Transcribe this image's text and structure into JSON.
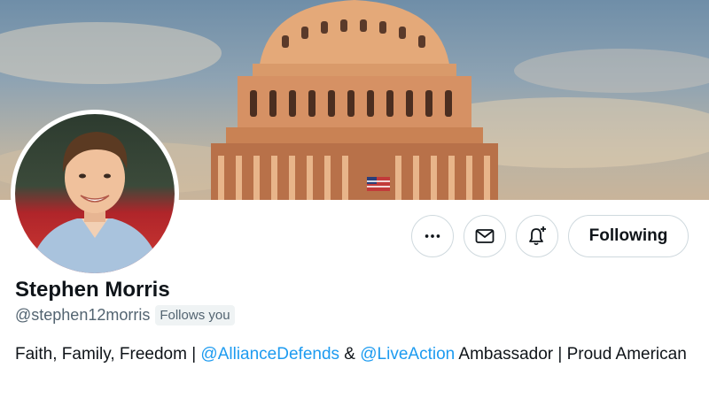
{
  "profile": {
    "display_name": "Stephen Morris",
    "handle": "@stephen12morris",
    "follows_you_label": "Follows you",
    "bio": {
      "part1": "Faith, Family, Freedom | ",
      "mention1": "@AllianceDefends",
      "part2": " & ",
      "mention2": "@LiveAction",
      "part3": " Ambassador | Proud American"
    }
  },
  "actions": {
    "more_icon": "more-horizontal-icon",
    "message_icon": "envelope-icon",
    "notify_icon": "bell-plus-icon",
    "following_label": "Following"
  },
  "colors": {
    "link": "#1d9bf0",
    "secondary_text": "#536471",
    "border": "#cfd9de"
  }
}
